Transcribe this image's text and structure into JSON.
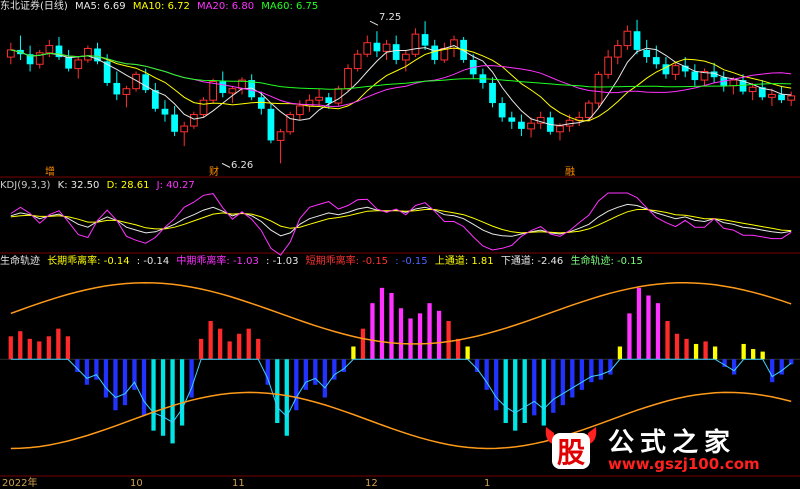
{
  "window": {
    "title": "东北证券(日线)"
  },
  "main_legend": [
    {
      "label": "MA5: 6.69",
      "color": "#e8e8e8"
    },
    {
      "label": "MA10: 6.72",
      "color": "#ffff00"
    },
    {
      "label": "MA20: 6.80",
      "color": "#ff33ff"
    },
    {
      "label": "MA60: 6.75",
      "color": "#22ff22"
    }
  ],
  "kdj_legend": [
    {
      "label": "KDJ(9,3,3)",
      "color": "#c8c8c8"
    },
    {
      "label": "K: 32.50",
      "color": "#e8e8e8"
    },
    {
      "label": "D: 28.61",
      "color": "#ffff00"
    },
    {
      "label": "J: 40.27",
      "color": "#ff33ff"
    }
  ],
  "lower_legend": [
    {
      "label": "生命轨迹",
      "color": "#e8e8e8"
    },
    {
      "label": "长期乖离率: -0.14",
      "color": "#ffff00"
    },
    {
      "label": ": -0.14",
      "color": "#e8e8e8"
    },
    {
      "label": "中期乖离率: -1.03",
      "color": "#ff33ff"
    },
    {
      "label": ": -1.03",
      "color": "#e8e8e8"
    },
    {
      "label": "短期乖离率: -0.15",
      "color": "#ff3333"
    },
    {
      "label": ": -0.15",
      "color": "#4f63ff"
    },
    {
      "label": "上通道: 1.81",
      "color": "#ffff00"
    },
    {
      "label": "下通道: -2.46",
      "color": "#e8e8e8"
    },
    {
      "label": "生命轨迹: -0.15",
      "color": "#7cff7c"
    }
  ],
  "annotations": {
    "high_label": "7.25",
    "low_label": "6.26",
    "flag_1": "增",
    "flag_2": "财",
    "flag_3": "融"
  },
  "x_axis_labels": [
    "2022年",
    "10",
    "11",
    "12",
    "1"
  ],
  "watermark": {
    "title": "公式之家",
    "url": "www.gszj100.com",
    "icon_char": "股"
  },
  "chart_data": [
    {
      "type": "candlestick",
      "title": "东北证券(日线)",
      "ylim": [
        6.2,
        7.3
      ],
      "ohlc": [
        [
          7.0,
          7.1,
          6.95,
          7.05
        ],
        [
          7.05,
          7.15,
          6.98,
          7.02
        ],
        [
          7.02,
          7.08,
          6.9,
          6.95
        ],
        [
          6.95,
          7.05,
          6.92,
          7.03
        ],
        [
          7.03,
          7.12,
          7.0,
          7.08
        ],
        [
          7.08,
          7.14,
          6.98,
          7.0
        ],
        [
          7.0,
          7.05,
          6.9,
          6.92
        ],
        [
          6.92,
          7.0,
          6.85,
          6.98
        ],
        [
          6.98,
          7.08,
          6.96,
          7.06
        ],
        [
          7.06,
          7.1,
          6.95,
          6.97
        ],
        [
          6.97,
          7.02,
          6.8,
          6.82
        ],
        [
          6.82,
          6.9,
          6.7,
          6.74
        ],
        [
          6.74,
          6.8,
          6.65,
          6.78
        ],
        [
          6.78,
          6.9,
          6.76,
          6.88
        ],
        [
          6.88,
          6.92,
          6.75,
          6.77
        ],
        [
          6.77,
          6.82,
          6.62,
          6.64
        ],
        [
          6.64,
          6.7,
          6.55,
          6.6
        ],
        [
          6.6,
          6.66,
          6.45,
          6.48
        ],
        [
          6.48,
          6.55,
          6.38,
          6.52
        ],
        [
          6.52,
          6.62,
          6.5,
          6.6
        ],
        [
          6.6,
          6.72,
          6.58,
          6.7
        ],
        [
          6.7,
          6.85,
          6.68,
          6.83
        ],
        [
          6.83,
          6.9,
          6.72,
          6.75
        ],
        [
          6.75,
          6.8,
          6.68,
          6.78
        ],
        [
          6.78,
          6.86,
          6.74,
          6.84
        ],
        [
          6.84,
          6.88,
          6.7,
          6.72
        ],
        [
          6.72,
          6.76,
          6.6,
          6.64
        ],
        [
          6.64,
          6.68,
          6.4,
          6.42
        ],
        [
          6.42,
          6.5,
          6.26,
          6.48
        ],
        [
          6.48,
          6.62,
          6.46,
          6.6
        ],
        [
          6.6,
          6.7,
          6.56,
          6.66
        ],
        [
          6.66,
          6.74,
          6.62,
          6.7
        ],
        [
          6.7,
          6.78,
          6.66,
          6.72
        ],
        [
          6.72,
          6.75,
          6.64,
          6.68
        ],
        [
          6.68,
          6.8,
          6.66,
          6.78
        ],
        [
          6.78,
          6.95,
          6.76,
          6.92
        ],
        [
          6.92,
          7.05,
          6.9,
          7.02
        ],
        [
          7.02,
          7.15,
          7.0,
          7.1
        ],
        [
          7.1,
          7.18,
          7.0,
          7.04
        ],
        [
          7.04,
          7.12,
          6.98,
          7.09
        ],
        [
          7.09,
          7.15,
          6.95,
          6.98
        ],
        [
          6.98,
          7.05,
          6.9,
          7.02
        ],
        [
          7.02,
          7.2,
          7.0,
          7.16
        ],
        [
          7.16,
          7.25,
          7.05,
          7.08
        ],
        [
          7.08,
          7.12,
          6.95,
          6.98
        ],
        [
          6.98,
          7.1,
          6.96,
          7.06
        ],
        [
          7.06,
          7.15,
          7.0,
          7.12
        ],
        [
          7.12,
          7.14,
          6.96,
          6.98
        ],
        [
          6.98,
          7.02,
          6.85,
          6.88
        ],
        [
          6.88,
          6.92,
          6.78,
          6.82
        ],
        [
          6.82,
          6.86,
          6.65,
          6.68
        ],
        [
          6.68,
          6.72,
          6.55,
          6.58
        ],
        [
          6.58,
          6.62,
          6.5,
          6.55
        ],
        [
          6.55,
          6.6,
          6.45,
          6.5
        ],
        [
          6.5,
          6.58,
          6.44,
          6.54
        ],
        [
          6.54,
          6.62,
          6.5,
          6.58
        ],
        [
          6.58,
          6.62,
          6.46,
          6.48
        ],
        [
          6.48,
          6.54,
          6.42,
          6.52
        ],
        [
          6.52,
          6.6,
          6.48,
          6.56
        ],
        [
          6.56,
          6.62,
          6.52,
          6.58
        ],
        [
          6.58,
          6.7,
          6.55,
          6.68
        ],
        [
          6.68,
          6.9,
          6.65,
          6.88
        ],
        [
          6.88,
          7.05,
          6.85,
          7.0
        ],
        [
          7.0,
          7.12,
          6.95,
          7.08
        ],
        [
          7.08,
          7.22,
          7.05,
          7.18
        ],
        [
          7.18,
          7.26,
          7.02,
          7.05
        ],
        [
          7.05,
          7.12,
          6.96,
          7.0
        ],
        [
          7.0,
          7.08,
          6.92,
          6.95
        ],
        [
          6.95,
          7.0,
          6.85,
          6.88
        ],
        [
          6.88,
          6.96,
          6.84,
          6.94
        ],
        [
          6.94,
          7.0,
          6.86,
          6.9
        ],
        [
          6.9,
          6.95,
          6.8,
          6.84
        ],
        [
          6.84,
          6.92,
          6.8,
          6.9
        ],
        [
          6.9,
          6.96,
          6.82,
          6.86
        ],
        [
          6.86,
          6.9,
          6.76,
          6.8
        ],
        [
          6.8,
          6.86,
          6.74,
          6.84
        ],
        [
          6.84,
          6.88,
          6.74,
          6.76
        ],
        [
          6.76,
          6.82,
          6.7,
          6.79
        ],
        [
          6.79,
          6.84,
          6.7,
          6.72
        ],
        [
          6.72,
          6.78,
          6.66,
          6.74
        ],
        [
          6.74,
          6.8,
          6.68,
          6.7
        ],
        [
          6.7,
          6.76,
          6.66,
          6.73
        ]
      ]
    },
    {
      "type": "line",
      "title": "KDJ(9,3,3)",
      "ylim": [
        0,
        100
      ],
      "series": [
        {
          "name": "K",
          "color": "#e8e8e8",
          "values": [
            60,
            65,
            62,
            55,
            60,
            63,
            55,
            45,
            40,
            50,
            58,
            52,
            40,
            35,
            30,
            32,
            38,
            45,
            55,
            62,
            70,
            75,
            68,
            60,
            65,
            60,
            50,
            35,
            25,
            30,
            45,
            55,
            60,
            65,
            62,
            66,
            72,
            75,
            70,
            68,
            70,
            66,
            72,
            75,
            70,
            62,
            60,
            55,
            45,
            35,
            28,
            25,
            24,
            28,
            32,
            35,
            30,
            28,
            32,
            38,
            45,
            58,
            68,
            75,
            80,
            78,
            72,
            65,
            60,
            55,
            58,
            52,
            50,
            55,
            48,
            45,
            40,
            38,
            35,
            32,
            30,
            33
          ]
        },
        {
          "name": "D",
          "color": "#ffff00",
          "values": [
            58,
            60,
            61,
            59,
            59,
            60,
            58,
            54,
            49,
            49,
            52,
            52,
            48,
            44,
            39,
            37,
            37,
            40,
            45,
            51,
            57,
            63,
            65,
            63,
            64,
            63,
            58,
            51,
            42,
            38,
            40,
            45,
            50,
            55,
            57,
            60,
            64,
            68,
            69,
            69,
            69,
            68,
            69,
            71,
            71,
            68,
            65,
            62,
            56,
            49,
            42,
            36,
            32,
            30,
            31,
            32,
            31,
            30,
            31,
            33,
            37,
            44,
            52,
            60,
            67,
            71,
            71,
            69,
            66,
            62,
            61,
            58,
            55,
            55,
            53,
            50,
            47,
            44,
            41,
            38,
            35,
            34
          ]
        },
        {
          "name": "J",
          "color": "#ff33ff",
          "values": [
            64,
            75,
            64,
            47,
            62,
            69,
            49,
            27,
            22,
            52,
            70,
            52,
            24,
            17,
            12,
            22,
            40,
            55,
            75,
            84,
            96,
            99,
            74,
            54,
            67,
            54,
            34,
            3,
            -9,
            14,
            55,
            75,
            80,
            85,
            72,
            78,
            88,
            89,
            72,
            66,
            72,
            62,
            78,
            83,
            68,
            50,
            50,
            41,
            23,
            7,
            0,
            3,
            8,
            24,
            34,
            41,
            28,
            24,
            34,
            48,
            61,
            86,
            100,
            100,
            100,
            92,
            74,
            57,
            48,
            41,
            52,
            40,
            40,
            55,
            38,
            35,
            26,
            26,
            23,
            20,
            20,
            31
          ]
        }
      ]
    },
    {
      "type": "bar",
      "title": "生命轨迹",
      "ylim": [
        -4.5,
        3.5
      ],
      "short_term_deviation": [
        0.9,
        1.1,
        0.8,
        0.7,
        0.9,
        1.2,
        0.9,
        -0.5,
        -1.0,
        -0.8,
        -1.5,
        -2.0,
        -1.8,
        -1.2,
        -2.2,
        -2.8,
        -3.0,
        -3.3,
        -2.6,
        -1.5,
        0.8,
        1.5,
        1.2,
        0.7,
        1.0,
        1.2,
        0.8,
        -1.0,
        -2.5,
        -3.0,
        -2.0,
        -1.2,
        -1.0,
        -1.5,
        -0.8,
        -0.5,
        0.5,
        1.2,
        2.2,
        2.8,
        2.6,
        2.0,
        1.6,
        1.8,
        2.2,
        1.9,
        1.5,
        0.8,
        0.5,
        -0.5,
        -1.2,
        -2.0,
        -2.5,
        -2.8,
        -2.5,
        -2.2,
        -2.6,
        -2.1,
        -1.8,
        -1.5,
        -1.2,
        -0.9,
        -0.8,
        -0.6,
        0.5,
        1.8,
        2.8,
        2.5,
        2.2,
        1.5,
        1.0,
        0.8,
        0.6,
        0.7,
        0.5,
        -0.3,
        -0.6,
        0.6,
        0.4,
        0.3,
        -0.9,
        -0.6,
        -0.2
      ]
    }
  ]
}
